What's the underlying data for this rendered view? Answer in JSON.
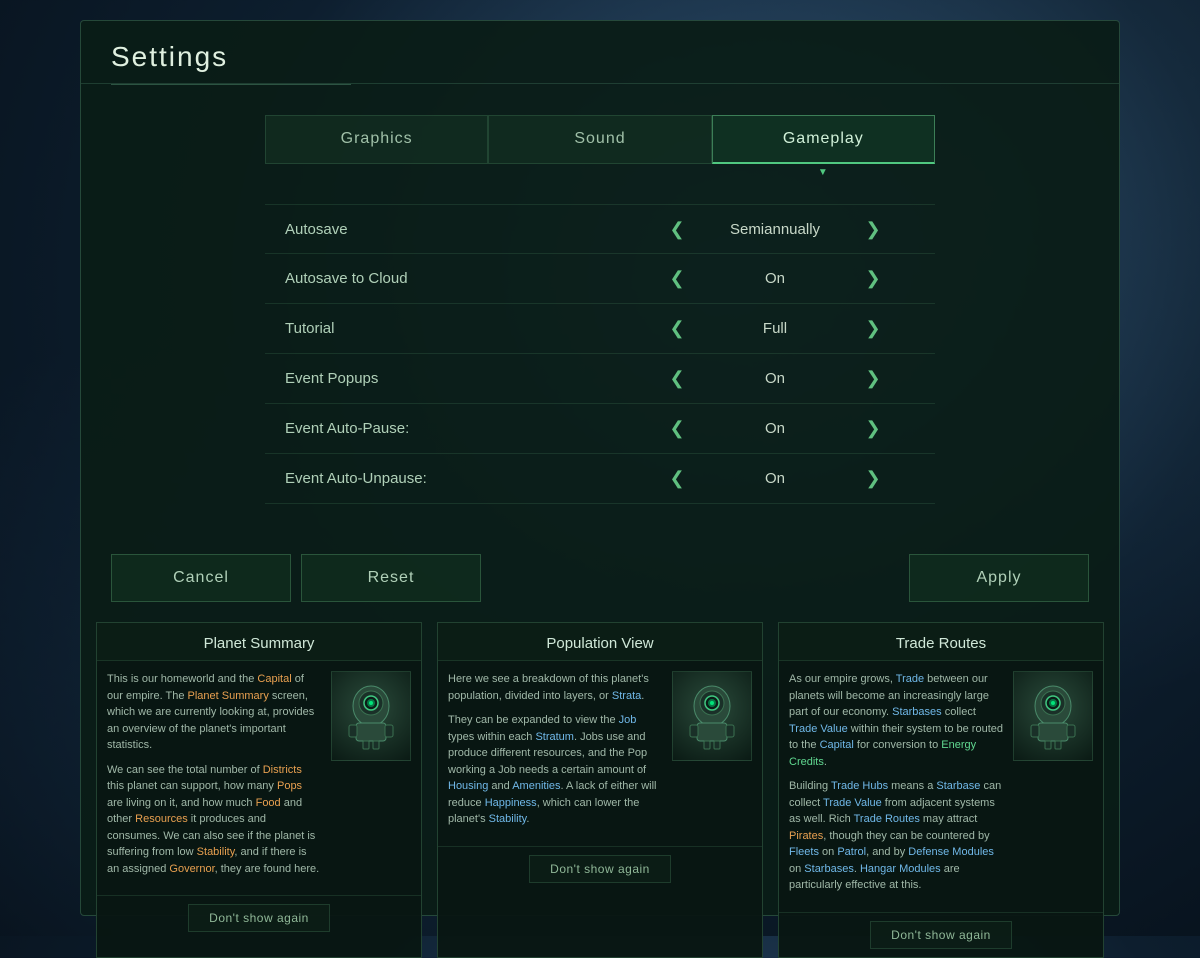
{
  "window": {
    "title": "Settings"
  },
  "tabs": [
    {
      "id": "graphics",
      "label": "Graphics",
      "active": false
    },
    {
      "id": "sound",
      "label": "Sound",
      "active": false
    },
    {
      "id": "gameplay",
      "label": "Gameplay",
      "active": true
    }
  ],
  "settings": [
    {
      "label": "Autosave",
      "value": "Semiannually"
    },
    {
      "label": "Autosave to Cloud",
      "value": "On"
    },
    {
      "label": "Tutorial",
      "value": "Full"
    },
    {
      "label": "Event Popups",
      "value": "On"
    },
    {
      "label": "Event Auto-Pause:",
      "value": "On"
    },
    {
      "label": "Event Auto-Unpause:",
      "value": "On"
    }
  ],
  "buttons": {
    "cancel": "Cancel",
    "reset": "Reset",
    "apply": "Apply"
  },
  "cards": [
    {
      "title": "Planet Summary",
      "text1": "This is our homeworld and the Capital of our empire. The Planet Summary screen, which we are currently looking at, provides an overview of the planet's important statistics.",
      "text2": "We can see the total number of Districts this planet can support, how many Pops are living on it, and how much Food and other Resources it produces and consumes. We can also see if the planet is suffering from low Stability, and if there is an assigned Governor, they are found here.",
      "highlights1": [
        "Capital",
        "Planet Summary"
      ],
      "highlights2": [
        "Districts",
        "Pops",
        "Food",
        "Resources",
        "Stability",
        "Governor"
      ],
      "dontShow": "Don't show again"
    },
    {
      "title": "Population View",
      "text1": "Here we see a breakdown of this planet's population, divided into layers, or Strata.",
      "text2": "They can be expanded to view the Job types within each Stratum. Jobs use and produce different resources, and the Pop working a Job needs a certain amount of Housing and Amenities. A lack of either will reduce Happiness, which can lower the planet's Stability.",
      "dontShow": "Don't show again"
    },
    {
      "title": "Trade Routes",
      "text1": "As our empire grows, Trade between our planets will become an increasingly large part of our economy. Starbases collect Trade Value within their system to be routed to the Capital for conversion to Energy Credits.",
      "text2": "Building Trade Hubs means a Starbase can collect Trade Value from adjacent systems as well. Rich Trade Routes may attract Pirates, though they can be countered by Fleets on Patrol, and by Defense Modules on Starbases. Hangar Modules are particularly effective at this.",
      "dontShow": "Don't show again"
    }
  ],
  "arrows": {
    "left": "❮",
    "right": "❯"
  }
}
